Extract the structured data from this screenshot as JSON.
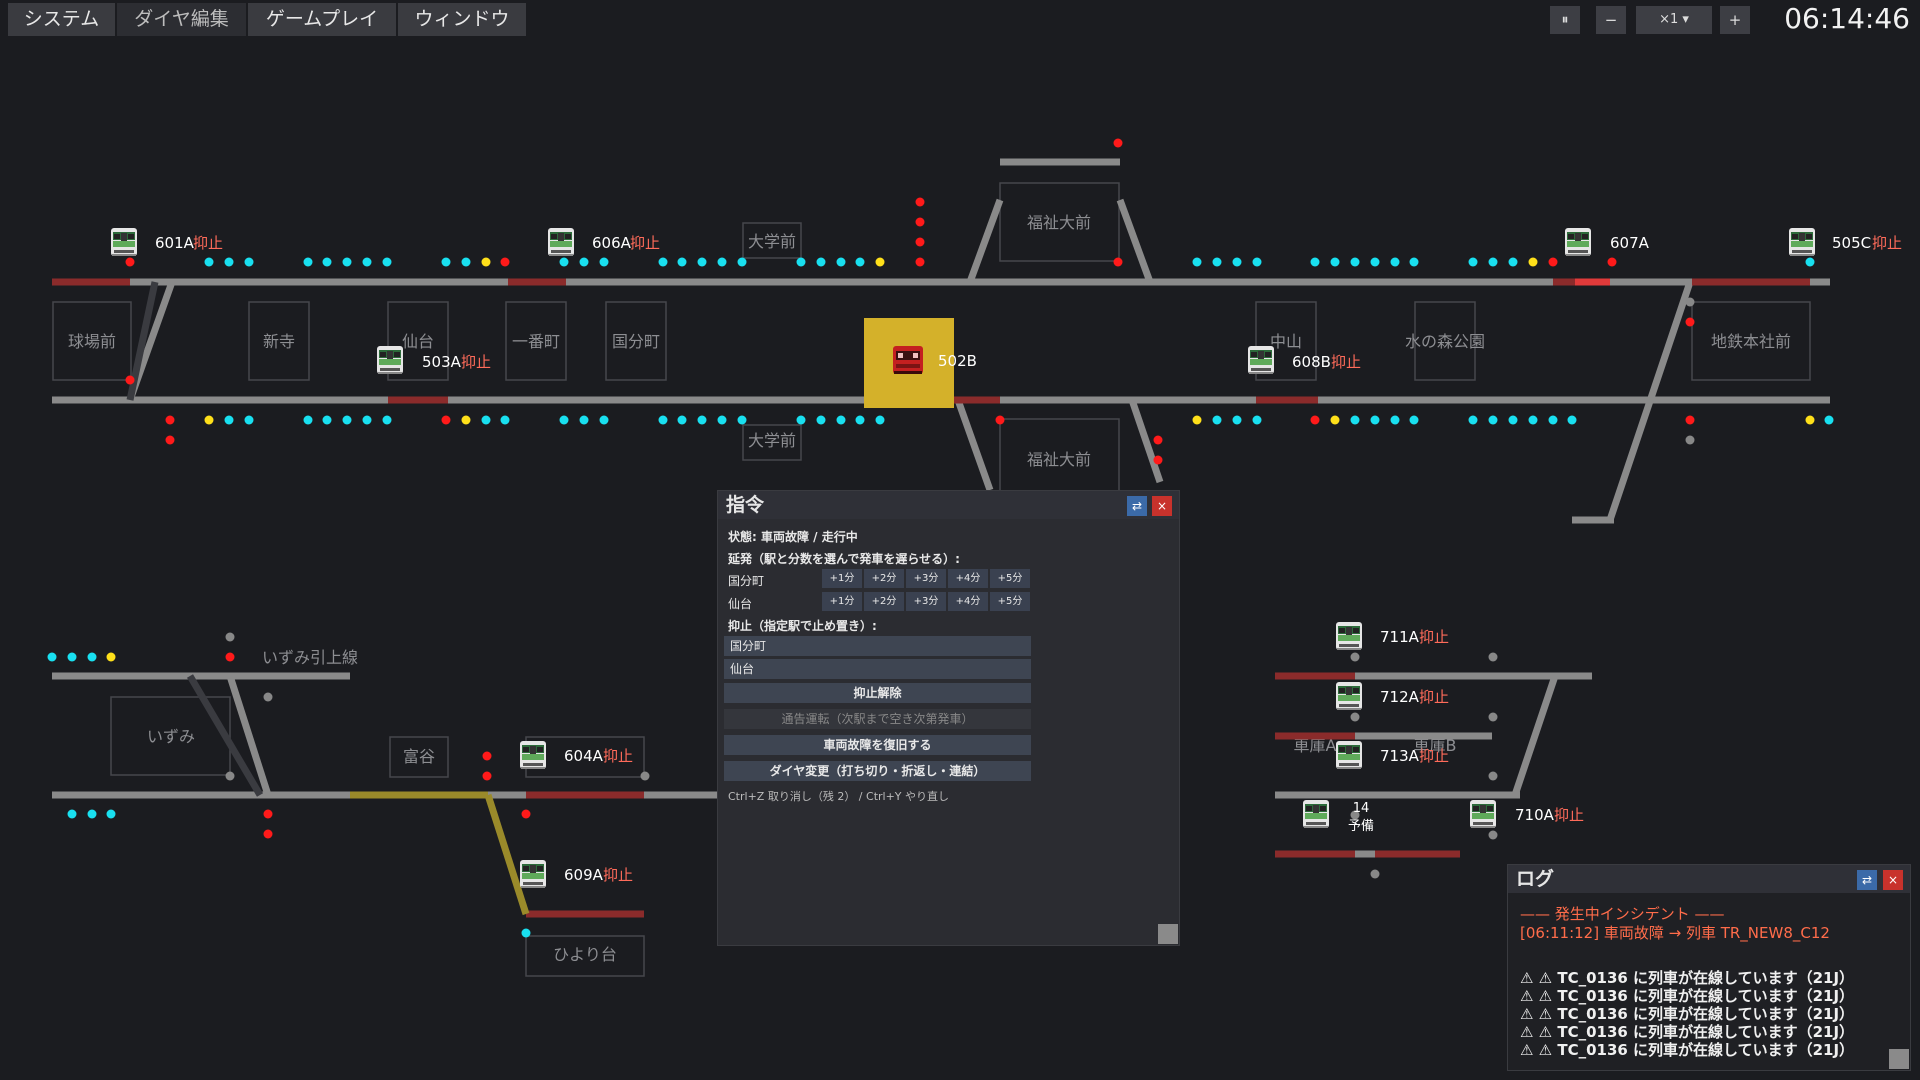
{
  "menu": [
    "システム",
    "ダイヤ編集",
    "ゲームプレイ",
    "ウィンドウ"
  ],
  "controls": {
    "pause": "⏸",
    "minus": "−",
    "speed": "×1 ▾",
    "plus": "+"
  },
  "clock": "06:14:46",
  "map": {
    "stations_upper": [
      "球場前",
      "新寺",
      "仙台",
      "一番町",
      "国分町",
      "大学前",
      "福祉大前",
      "中山",
      "水の森公園",
      "地鉄本社前"
    ],
    "stations_lower": [
      "いずみ",
      "富谷",
      "ひより台",
      "いずみ引上線",
      "大学前",
      "福祉大前",
      "車庫A",
      "車庫B"
    ],
    "trains": [
      {
        "id": "601A",
        "status": "抑止"
      },
      {
        "id": "606A",
        "status": "抑止"
      },
      {
        "id": "607A",
        "status": ""
      },
      {
        "id": "505C",
        "status": "抑止"
      },
      {
        "id": "503A",
        "status": "抑止"
      },
      {
        "id": "502B",
        "status": ""
      },
      {
        "id": "608B",
        "status": "抑止"
      },
      {
        "id": "604A",
        "status": "抑止"
      },
      {
        "id": "609A",
        "status": "抑止"
      },
      {
        "id": "711A",
        "status": "抑止"
      },
      {
        "id": "712A",
        "status": "抑止"
      },
      {
        "id": "713A",
        "status": "抑止"
      },
      {
        "id": "710A",
        "status": "抑止"
      },
      {
        "id": "14",
        "status": "予備"
      }
    ],
    "colors": {
      "track": "#8a8a8a",
      "occupied": "#8b2b2b",
      "signal_clear": "#19e0f0",
      "signal_stop": "#ff1a1a",
      "signal_caution": "#ffe01a",
      "selected": "#d4b12a",
      "route": "#9a8a2a"
    }
  },
  "command": {
    "title": "指令",
    "status": "状態: 車両故障 / 走行中",
    "delay_heading": "延発（駅と分数を選んで発車を遅らせる）:",
    "delay_rows": [
      {
        "station": "国分町",
        "options": [
          "+1分",
          "+2分",
          "+3分",
          "+4分",
          "+5分"
        ]
      },
      {
        "station": "仙台",
        "options": [
          "+1分",
          "+2分",
          "+3分",
          "+4分",
          "+5分"
        ]
      }
    ],
    "hold_heading": "抑止（指定駅で止め置き）:",
    "hold_stations": [
      "国分町",
      "仙台"
    ],
    "release": "抑止解除",
    "pass_through": "通告運転（次駅まで空き次第発車）",
    "repair": "車両故障を復旧する",
    "diagram_change": "ダイヤ変更（打ち切り・折返し・連結）",
    "hint": "Ctrl+Z 取り消し（残 2） / Ctrl+Y やり直し",
    "swap_icon": "⇄",
    "close_icon": "×"
  },
  "log": {
    "title": "ログ",
    "incident_heading": "—— 発生中インシデント ——",
    "incident": "[06:11:12] 車両故障 → 列車 TR_NEW8_C12",
    "warnings": [
      "⚠ ⚠ TC_0136 に列車が在線しています（21J）",
      "⚠ ⚠ TC_0136 に列車が在線しています（21J）",
      "⚠ ⚠ TC_0136 に列車が在線しています（21J）",
      "⚠ ⚠ TC_0136 に列車が在線しています（21J）",
      "⚠ ⚠ TC_0136 に列車が在線しています（21J）"
    ],
    "swap_icon": "⇄",
    "close_icon": "×"
  }
}
